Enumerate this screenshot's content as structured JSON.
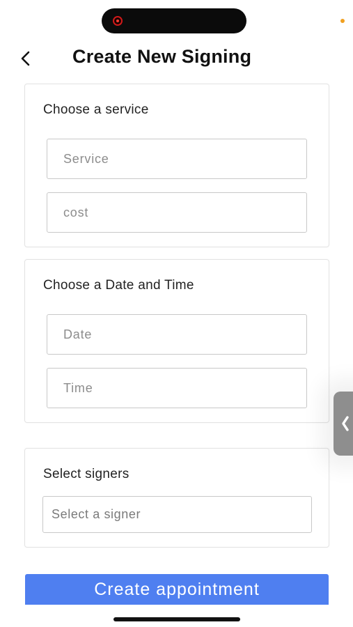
{
  "header": {
    "title": "Create New Signing"
  },
  "service_card": {
    "title": "Choose a service",
    "service_placeholder": "Service",
    "cost_placeholder": "cost"
  },
  "datetime_card": {
    "title": "Choose a Date and Time",
    "date_placeholder": "Date",
    "time_placeholder": "Time"
  },
  "signers_card": {
    "title": "Select signers",
    "select_placeholder": "Select a signer"
  },
  "actions": {
    "create_label": "Create appointment"
  },
  "colors": {
    "primary": "#4f7ff0",
    "recording_indicator": "#ff3b30",
    "status_dot": "#f0a020"
  },
  "icons": {
    "back": "chevron-left-icon",
    "side_tab": "chevron-left-icon",
    "recording": "recording-dot-icon"
  }
}
